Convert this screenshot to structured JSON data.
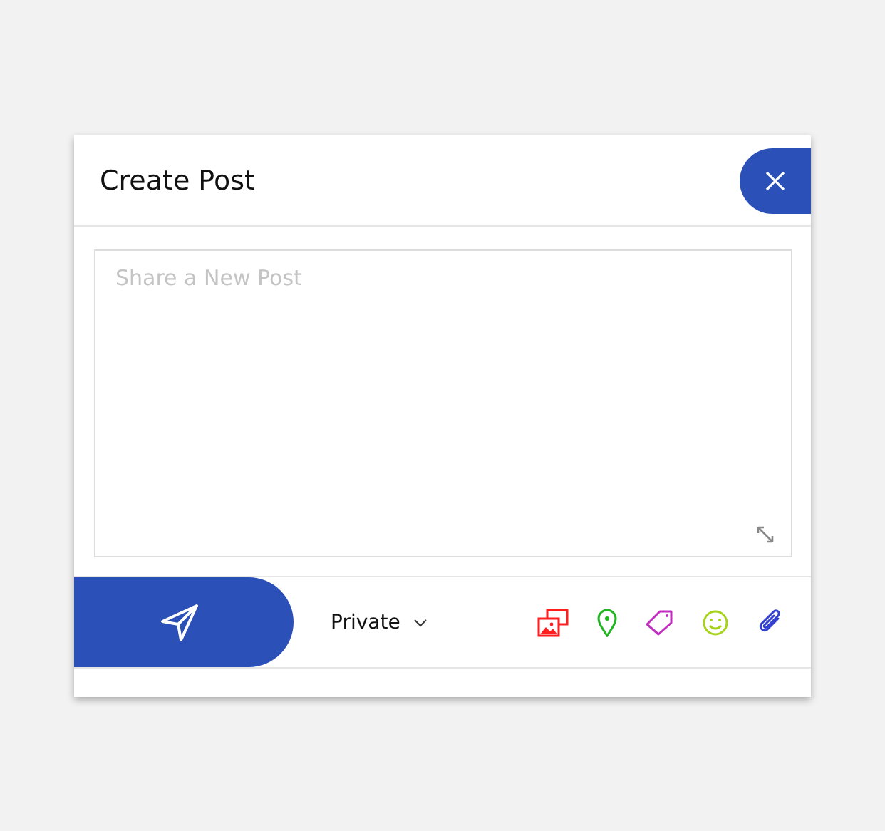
{
  "dialog": {
    "title": "Create Post"
  },
  "post_field": {
    "placeholder": "Share a New Post"
  },
  "privacy": {
    "value": "Private"
  },
  "tools": [
    {
      "kind": "photos",
      "color": "#ff1f1f"
    },
    {
      "kind": "location",
      "color": "#22b422"
    },
    {
      "kind": "tag",
      "color": "#c02ec0"
    },
    {
      "kind": "emoji",
      "color": "#a6d21a"
    },
    {
      "kind": "attach",
      "color": "#3340d0"
    }
  ]
}
